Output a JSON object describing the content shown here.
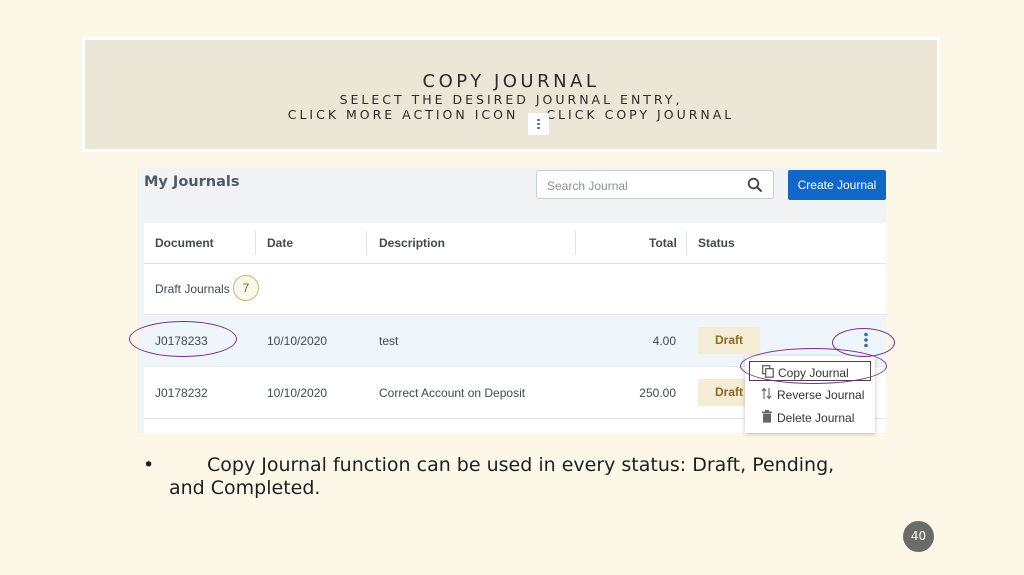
{
  "slide": {
    "title": "COPY JOURNAL",
    "subtitle_line1": "SELECT THE DESIRED JOURNAL ENTRY,",
    "subtitle_line2_a": "CLICK MORE ACTION ICON",
    "subtitle_line2_b": "CLICK COPY JOURNAL",
    "bullet_text": "Copy Journal function can be used in every status: Draft, Pending, and Completed.",
    "page_number": "40"
  },
  "app": {
    "page_title": "My Journals",
    "search": {
      "placeholder": "Search Journal",
      "value": ""
    },
    "create_button": "Create Journal",
    "table": {
      "headers": [
        "Document",
        "Date",
        "Description",
        "Total",
        "Status"
      ],
      "group": {
        "label": "Draft Journals",
        "count": "7"
      },
      "rows": [
        {
          "document": "J0178233",
          "date": "10/10/2020",
          "description": "test",
          "total": "4.00",
          "status": "Draft"
        },
        {
          "document": "J0178232",
          "date": "10/10/2020",
          "description": "Correct Account on Deposit",
          "total": "250.00",
          "status": "Draft"
        }
      ]
    },
    "action_menu": {
      "items": [
        {
          "label": "Copy Journal",
          "icon": "copy-icon"
        },
        {
          "label": "Reverse Journal",
          "icon": "reverse-arrows-icon"
        },
        {
          "label": "Delete Journal",
          "icon": "trash-icon"
        }
      ]
    }
  },
  "colors": {
    "slide_background": "#fdf7e7",
    "title_box": "#ece6d6",
    "primary_button": "#1167c7",
    "draft_badge": "#f5ecd6",
    "annotation": "#7b2d88"
  }
}
